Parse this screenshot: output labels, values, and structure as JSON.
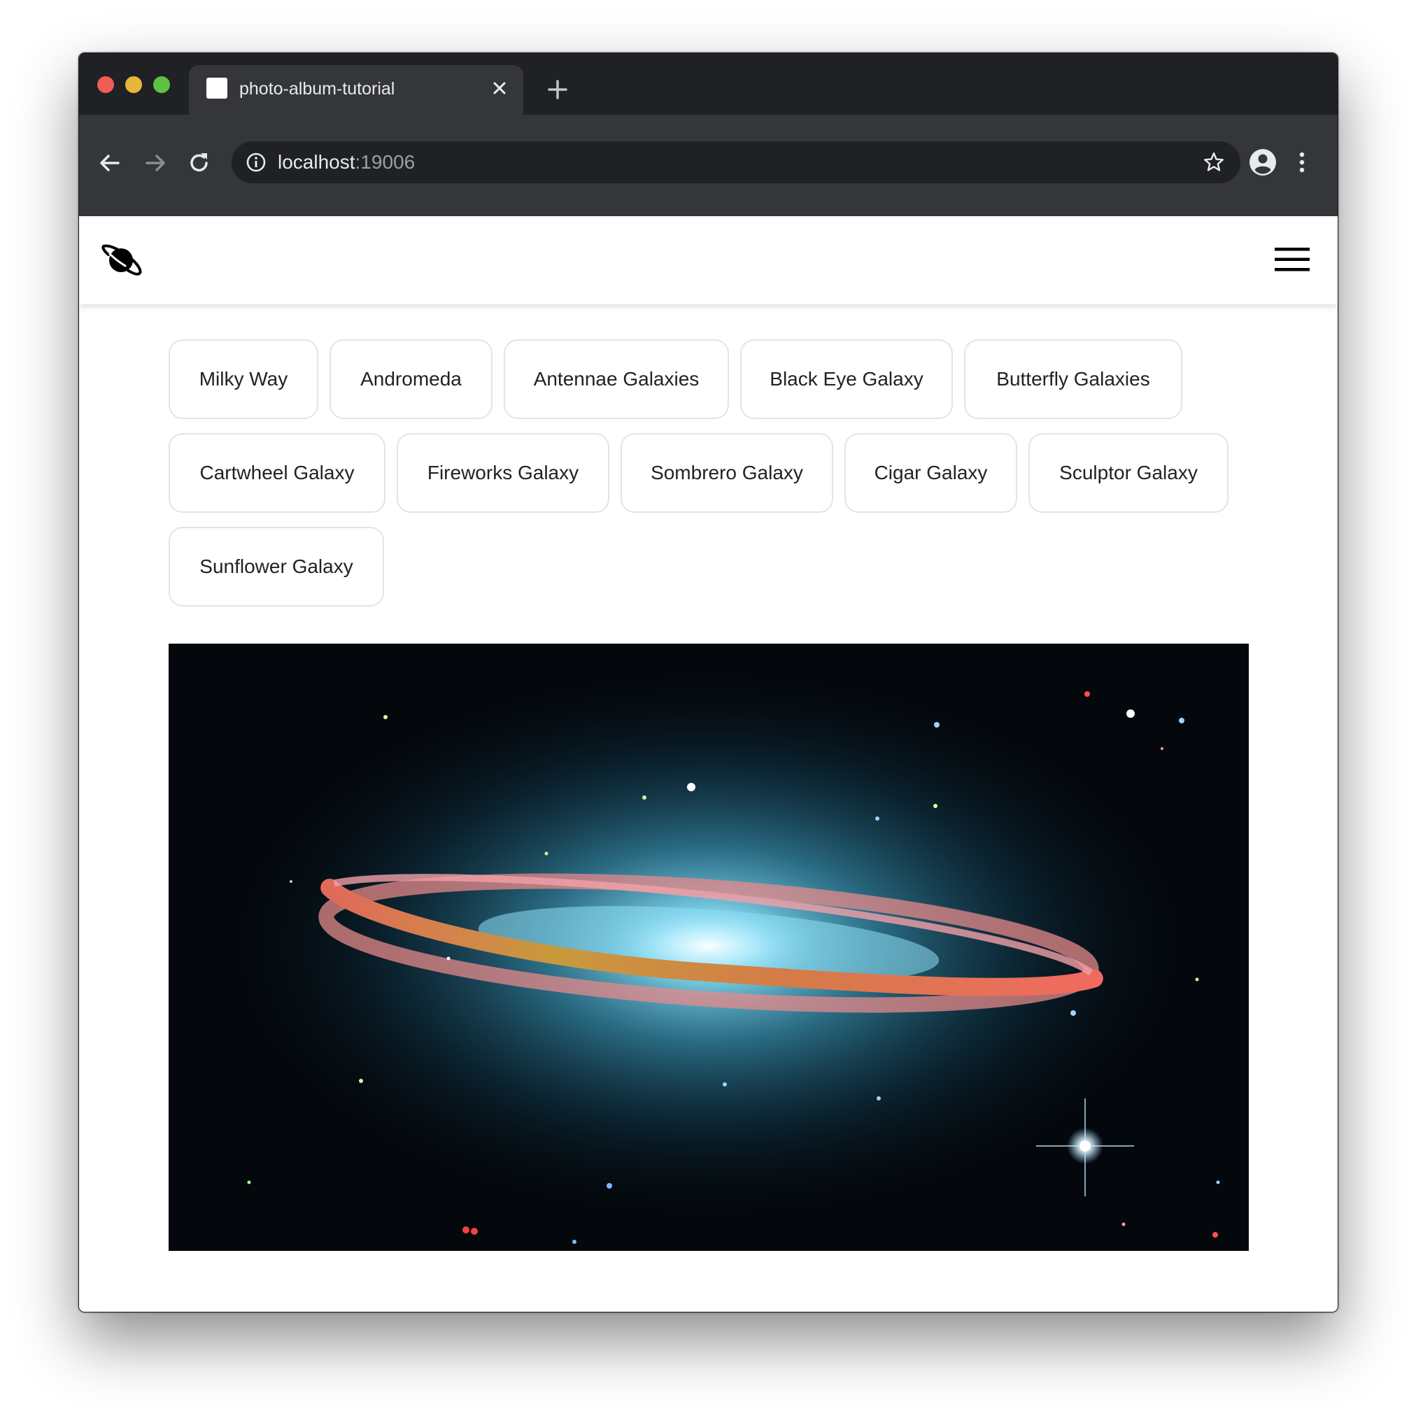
{
  "browser": {
    "tab_title": "photo-album-tutorial",
    "url_host": "localhost",
    "url_port": ":19006"
  },
  "app": {
    "logo_icon": "planet-icon",
    "menu_icon": "hamburger-icon"
  },
  "gallery": {
    "buttons": [
      "Milky Way",
      "Andromeda",
      "Antennae Galaxies",
      "Black Eye Galaxy",
      "Butterfly Galaxies",
      "Cartwheel Galaxy",
      "Fireworks Galaxy",
      "Sombrero Galaxy",
      "Cigar Galaxy",
      "Sculptor Galaxy",
      "Sunflower Galaxy"
    ]
  },
  "colors": {
    "tabstrip": "#202124",
    "toolbar": "#35363a",
    "chip_border": "#e4e4e4"
  }
}
